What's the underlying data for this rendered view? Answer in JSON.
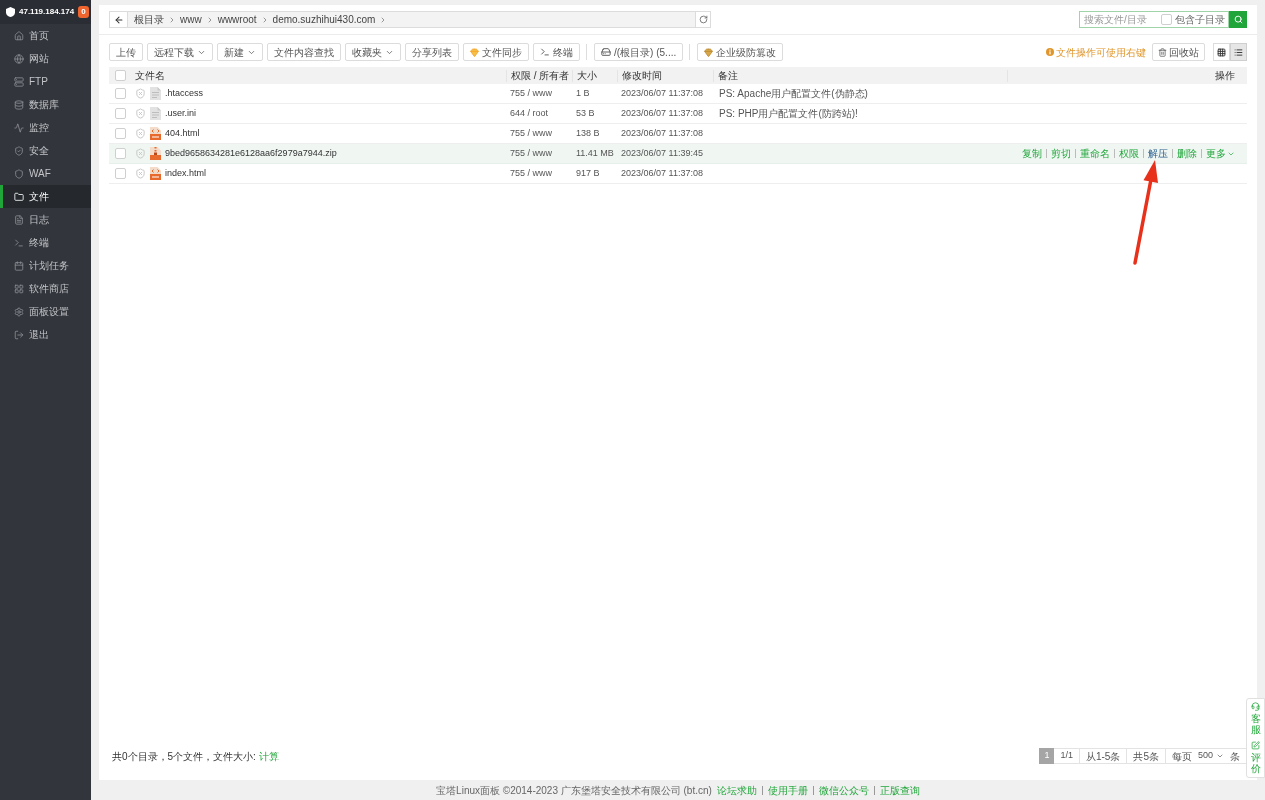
{
  "sidebar": {
    "host": "47.119.184.174",
    "badge": "0",
    "items": [
      {
        "label": "首页",
        "kind": "home",
        "selected": false
      },
      {
        "label": "网站",
        "kind": "site",
        "selected": false
      },
      {
        "label": "FTP",
        "kind": "ftp",
        "selected": false
      },
      {
        "label": "数据库",
        "kind": "database",
        "selected": false
      },
      {
        "label": "监控",
        "kind": "monitor",
        "selected": false
      },
      {
        "label": "安全",
        "kind": "security",
        "selected": false
      },
      {
        "label": "WAF",
        "kind": "waf",
        "selected": false
      },
      {
        "label": "文件",
        "kind": "files",
        "selected": true
      },
      {
        "label": "日志",
        "kind": "logs",
        "selected": false
      },
      {
        "label": "终端",
        "kind": "terminal",
        "selected": false
      },
      {
        "label": "计划任务",
        "kind": "cron",
        "selected": false
      },
      {
        "label": "软件商店",
        "kind": "store",
        "selected": false
      },
      {
        "label": "面板设置",
        "kind": "settings",
        "selected": false
      },
      {
        "label": "退出",
        "kind": "logout",
        "selected": false
      }
    ]
  },
  "breadcrumb": [
    "根目录",
    "www",
    "wwwroot",
    "demo.suzhihui430.com"
  ],
  "search": {
    "placeholder": "搜索文件/目录",
    "option": {
      "label": "包含子目录",
      "checked": false
    }
  },
  "toolbar": {
    "buttons": [
      {
        "label": "上传",
        "kind": "plain",
        "separated": false
      },
      {
        "label": "远程下载",
        "kind": "dropdown",
        "separated": false
      },
      {
        "label": "新建",
        "kind": "dropdown",
        "separated": false
      },
      {
        "label": "文件内容查找",
        "kind": "plain",
        "separated": false
      },
      {
        "label": "收藏夹",
        "kind": "dropdown",
        "separated": false
      },
      {
        "label": "分享列表",
        "kind": "plain",
        "separated": false
      },
      {
        "label": "文件同步",
        "kind": "gem",
        "separated": false
      },
      {
        "label": "终端",
        "kind": "terminal",
        "separated": false
      },
      {
        "label": "/(根目录) (5....",
        "kind": "disk",
        "separated": true
      },
      {
        "label": "企业级防篡改",
        "kind": "gem",
        "separated": true
      }
    ],
    "hint": "文件操作可使用右键",
    "recycle_bin": "回收站",
    "views": [
      {
        "kind": "grid",
        "selected": false
      },
      {
        "kind": "list",
        "selected": true
      }
    ]
  },
  "table": {
    "header_checked": false,
    "columns": [
      "文件名",
      "权限 / 所有者",
      "大小",
      "修改时间",
      "备注",
      "操作"
    ],
    "rows": [
      {
        "name": ".htaccess",
        "kind": "text",
        "checked": false,
        "highlighted": false,
        "permissions": "755 / www",
        "size": "1 B",
        "modified": "2023/06/07 11:37:08",
        "remark": "PS: Apache用户配置文件(伪静态)"
      },
      {
        "name": ".user.ini",
        "kind": "text",
        "checked": false,
        "highlighted": false,
        "permissions": "644 / root",
        "size": "53 B",
        "modified": "2023/06/07 11:37:08",
        "remark": "PS: PHP用户配置文件(防跨站)!"
      },
      {
        "name": "404.html",
        "kind": "code",
        "checked": false,
        "highlighted": false,
        "permissions": "755 / www",
        "size": "138 B",
        "modified": "2023/06/07 11:37:08"
      },
      {
        "name": "9bed9658634281e6128aa6f2979a7944.zip",
        "kind": "archive",
        "checked": false,
        "highlighted": true,
        "permissions": "755 / www",
        "size": "11.41 MB",
        "modified": "2023/06/07 11:39:45",
        "actions": [
          {
            "label": "复制",
            "kind": "link",
            "highlighted": false
          },
          {
            "label": "剪切",
            "kind": "link",
            "highlighted": false
          },
          {
            "label": "重命名",
            "kind": "link",
            "highlighted": false
          },
          {
            "label": "权限",
            "kind": "link",
            "highlighted": false
          },
          {
            "label": "解压",
            "kind": "link",
            "highlighted": true
          },
          {
            "label": "删除",
            "kind": "link",
            "highlighted": false
          },
          {
            "label": "更多",
            "kind": "dropdown",
            "highlighted": false
          }
        ]
      },
      {
        "name": "index.html",
        "kind": "code",
        "checked": false,
        "highlighted": false,
        "permissions": "755 / www",
        "size": "917 B",
        "modified": "2023/06/07 11:37:08"
      }
    ]
  },
  "summary": {
    "text": "共0个目录，5个文件，文件大小:",
    "link": "计算"
  },
  "pagination": {
    "pages": [
      {
        "label": "1",
        "selected": true
      }
    ],
    "total_pages": "1/1",
    "range": "从1-5条",
    "total": "共5条",
    "per_page_label": "每页",
    "per_page": "500",
    "unit": "条"
  },
  "footer": {
    "copyright": "宝塔Linux面板 ©2014-2023 广东堡塔安全技术有限公司 (bt.cn)",
    "links": [
      "论坛求助",
      "使用手册",
      "微信公众号",
      "正版查询"
    ]
  },
  "side_widget": [
    {
      "label": "客服",
      "kind": "support"
    },
    {
      "label": "评价",
      "kind": "review"
    }
  ]
}
